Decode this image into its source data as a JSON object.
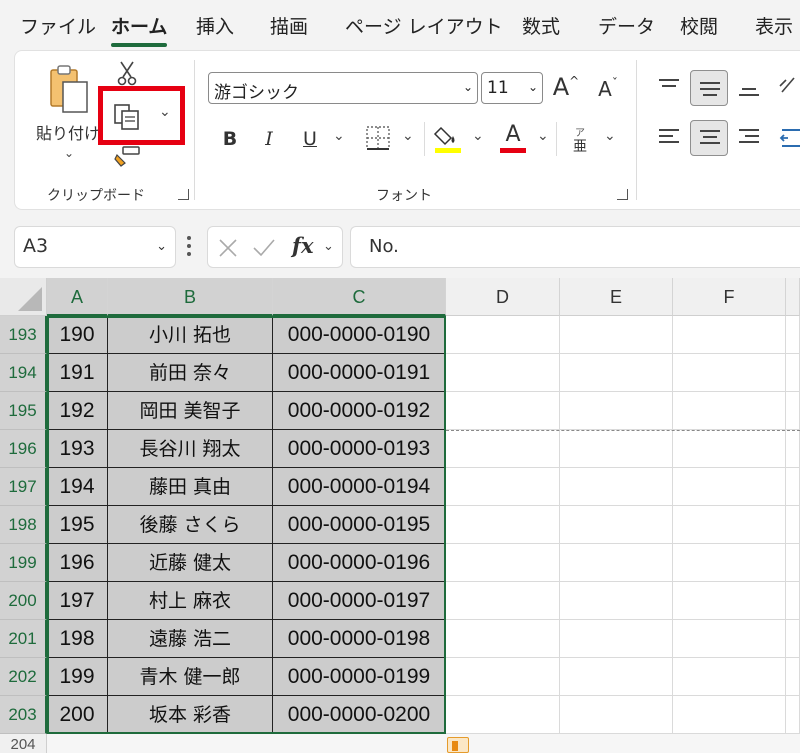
{
  "tabs": [
    "ファイル",
    "ホーム",
    "挿入",
    "描画",
    "ページ レイアウト",
    "数式",
    "データ",
    "校閲",
    "表示"
  ],
  "ribbon": {
    "paste_label": "貼り付け",
    "font_name": "游ゴシック",
    "font_size": "11",
    "grow_label": "A",
    "shrink_label": "A",
    "bold_label": "B",
    "italic_label": "I",
    "underline_label": "U",
    "font_color_label": "A",
    "phonetic_top": "ア",
    "phonetic_bottom": "亜",
    "clipboard_group_label": "クリップボード",
    "font_group_label": "フォント"
  },
  "formula_bar": {
    "name_box": "A3",
    "fx_label": "fx",
    "content": "No."
  },
  "columns": [
    "A",
    "B",
    "C",
    "D",
    "E",
    "F"
  ],
  "row_numbers": [
    "193",
    "194",
    "195",
    "196",
    "197",
    "198",
    "199",
    "200",
    "201",
    "202",
    "203"
  ],
  "next_row_number": "204",
  "rows": [
    {
      "no": "190",
      "name": "小川 拓也",
      "phone": "000-0000-0190"
    },
    {
      "no": "191",
      "name": "前田 奈々",
      "phone": "000-0000-0191"
    },
    {
      "no": "192",
      "name": "岡田 美智子",
      "phone": "000-0000-0192"
    },
    {
      "no": "193",
      "name": "長谷川 翔太",
      "phone": "000-0000-0193"
    },
    {
      "no": "194",
      "name": "藤田 真由",
      "phone": "000-0000-0194"
    },
    {
      "no": "195",
      "name": "後藤 さくら",
      "phone": "000-0000-0195"
    },
    {
      "no": "196",
      "name": "近藤 健太",
      "phone": "000-0000-0196"
    },
    {
      "no": "197",
      "name": "村上 麻衣",
      "phone": "000-0000-0197"
    },
    {
      "no": "198",
      "name": "遠藤 浩二",
      "phone": "000-0000-0198"
    },
    {
      "no": "199",
      "name": "青木 健一郎",
      "phone": "000-0000-0199"
    },
    {
      "no": "200",
      "name": "坂本 彩香",
      "phone": "000-0000-0200"
    }
  ],
  "colors": {
    "accent_green": "#1e6b3c",
    "highlight_red": "#e60012",
    "fill_yellow": "#ffff00",
    "font_red": "#e60012"
  }
}
